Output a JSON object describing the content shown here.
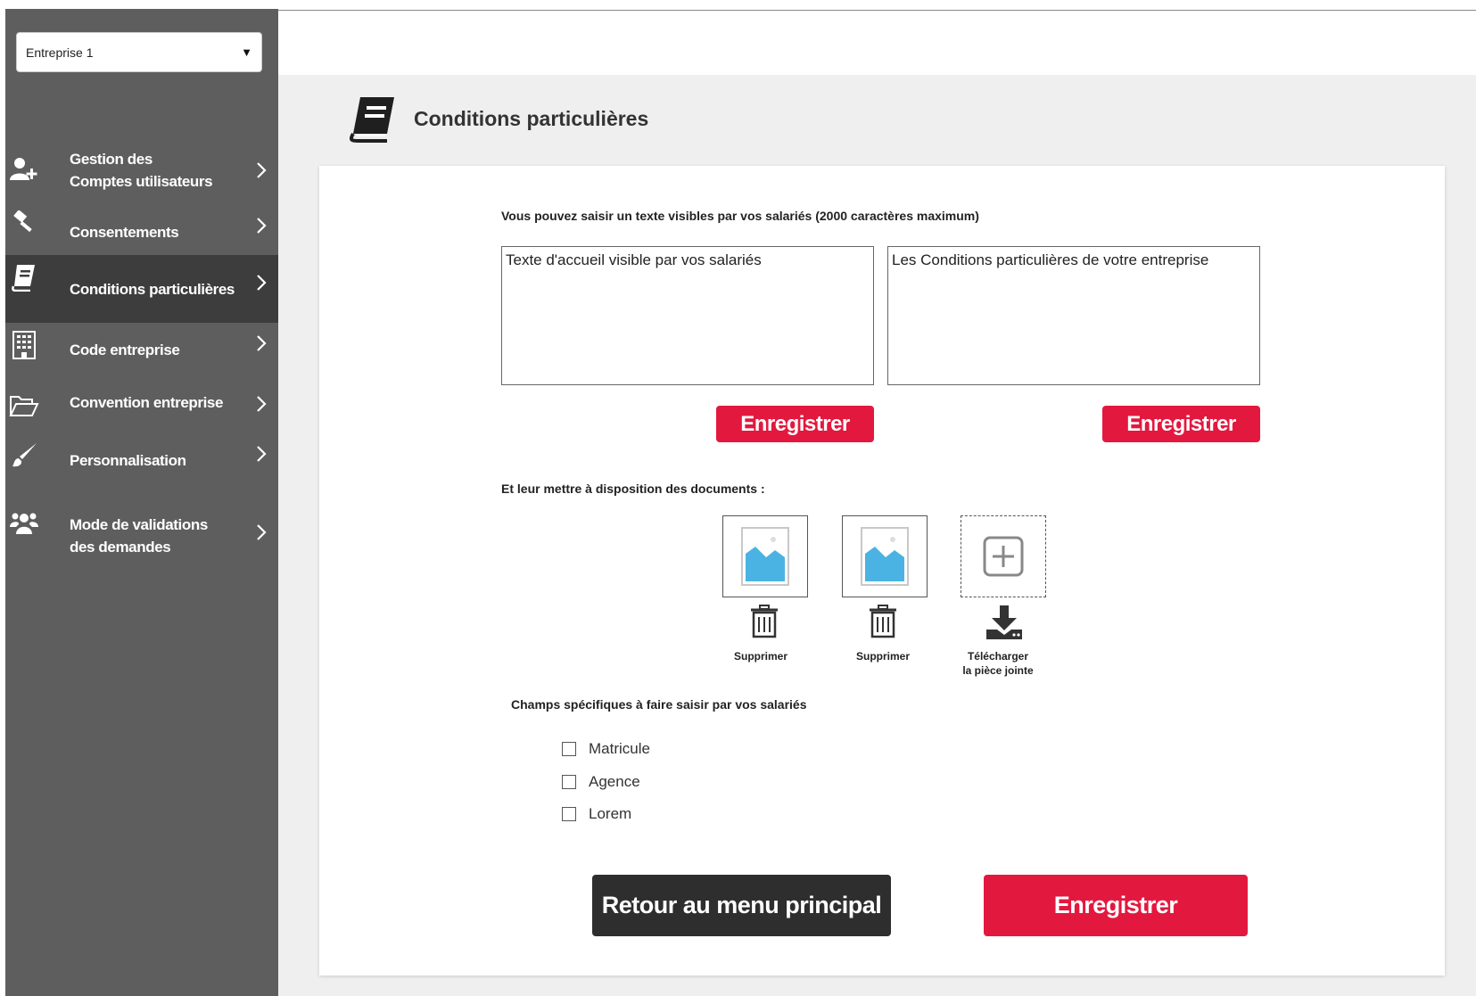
{
  "company_select": {
    "value": "Entreprise 1"
  },
  "sidebar": {
    "items": [
      {
        "label_line1": "Gestion des",
        "label_line2": "Comptes utilisateurs",
        "icon": "user-plus-icon"
      },
      {
        "label_line1": "Consentements",
        "icon": "gavel-icon"
      },
      {
        "label_line1": "Conditions particulières",
        "icon": "book-icon",
        "active": true
      },
      {
        "label_line1": "Code entreprise",
        "icon": "building-icon"
      },
      {
        "label_line1": "Convention  entreprise",
        "icon": "folder-open-icon"
      },
      {
        "label_line1": "Personnalisation",
        "icon": "paintbrush-icon"
      },
      {
        "label_line1": "Mode de validations",
        "label_line2": "des demandes",
        "icon": "users-icon"
      }
    ]
  },
  "page": {
    "title": "Conditions particulières"
  },
  "texts_section": {
    "instruction": "Vous pouvez saisir un texte visibles par vos salariés (2000 caractères maximum)",
    "welcome_text": "Texte d'accueil visible par vos salariés",
    "conditions_text": "Les Conditions particulières de votre entreprise",
    "save_label": "Enregistrer"
  },
  "documents_section": {
    "title": "Et leur mettre à disposition des documents :",
    "delete_label": "Supprimer",
    "download_line1": "Télécharger",
    "download_line2": "la pièce jointe"
  },
  "fields_section": {
    "title": "Champs spécifiques à faire saisir par vos salariés",
    "options": [
      "Matricule",
      "Agence",
      "Lorem"
    ]
  },
  "footer": {
    "back_label": "Retour au menu principal",
    "save_label": "Enregistrer"
  },
  "colors": {
    "accent": "#e3183f",
    "sidebar": "#5e5e5e",
    "sidebar_active": "#3d3d3d",
    "dark_button": "#2e2e2e"
  }
}
